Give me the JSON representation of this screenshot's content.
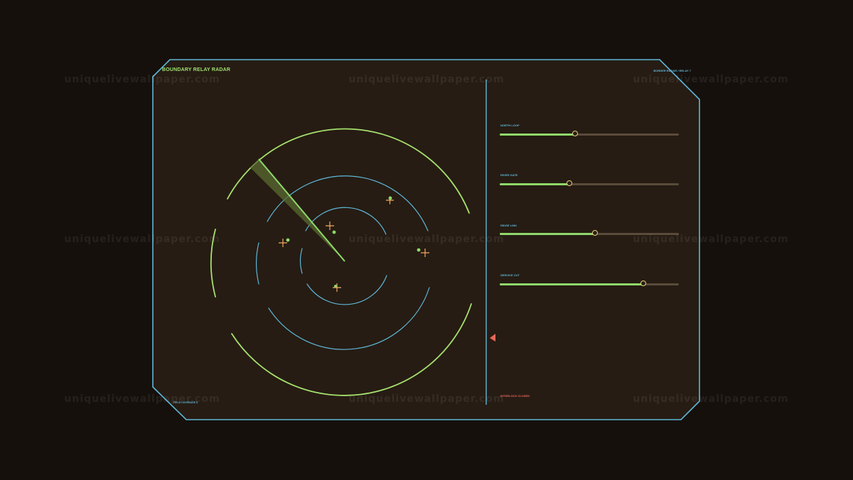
{
  "app": {
    "title": "BOUNDARY RELAY RADAR",
    "relay_id": "BORDER RADAR / RELAY 7",
    "bottom_left_label": "FIELD COVERAGE 8",
    "status": "INTERLOCK CLOSED"
  },
  "watermark": "uniquelivewallpaper.com",
  "sliders": [
    {
      "label": "NORTH LOOP",
      "value": 0.42
    },
    {
      "label": "RIVER GATE",
      "value": 0.39
    },
    {
      "label": "RIDGE LINK",
      "value": 0.53
    },
    {
      "label": "SERVICE CUT",
      "value": 0.8
    }
  ],
  "colors": {
    "background": "#16100c",
    "panel": "#261c13",
    "frame": "#5fb6d8",
    "ring_outer": "#a6e06e",
    "ring_inner": "#5fb6d8",
    "sweep": "#8fd86a",
    "contact_cross": "#f0a860",
    "contact_dot": "#8fd86a",
    "alert": "#e8675a",
    "thumb": "#e6cf7a"
  },
  "icons": {
    "contact_marker": "crosshair-plus",
    "edge_marker": "triangle-left"
  }
}
